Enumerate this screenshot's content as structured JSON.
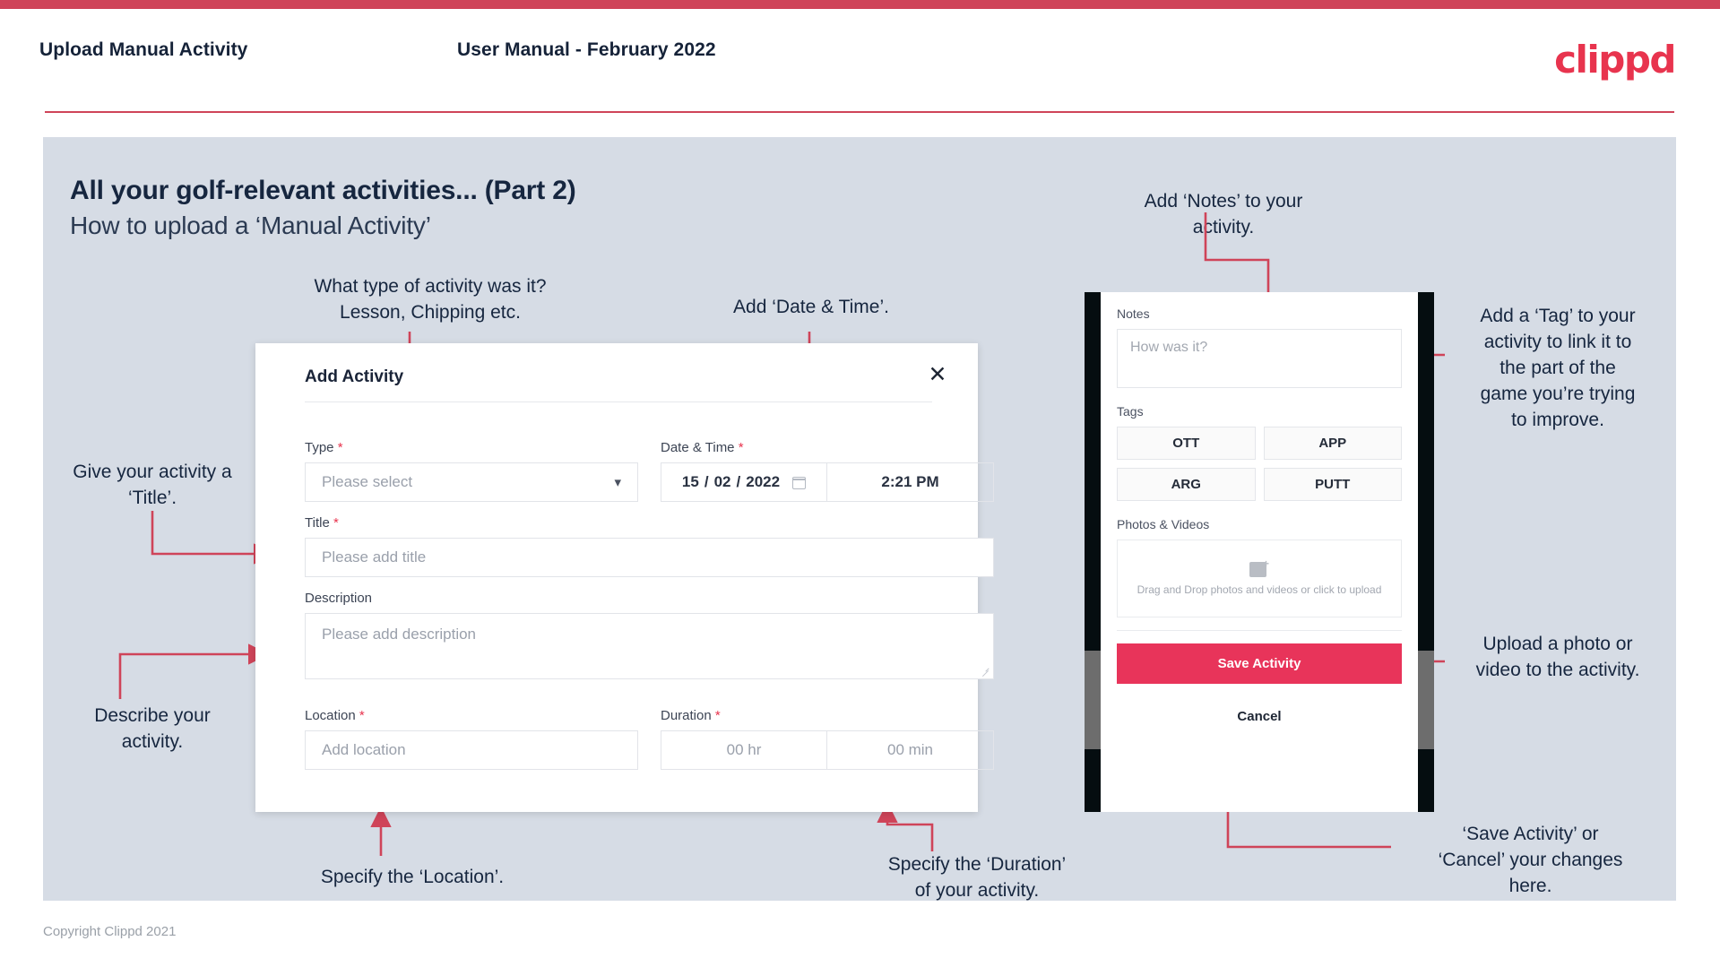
{
  "header": {
    "title": "Upload Manual Activity",
    "subtitle": "User Manual - February 2022",
    "brand": "clippd",
    "accent_color": "#cf4459"
  },
  "slide": {
    "title": "All your golf-relevant activities... (Part 2)",
    "subtitle": "How to upload a ‘Manual Activity’",
    "background_color": "#d6dce5"
  },
  "annotations": {
    "type": "What type of activity was it?\nLesson, Chipping etc.",
    "datetime": "Add ‘Date & Time’.",
    "notes": "Add ‘Notes’ to your\nactivity.",
    "tag": "Add a ‘Tag’ to your\nactivity to link it to\nthe part of the\ngame you’re trying\nto improve.",
    "title_field": "Give your activity a\n‘Title’.",
    "description": "Describe your\nactivity.",
    "upload": "Upload a photo or\nvideo to the activity.",
    "save_cancel": "‘Save Activity’ or\n‘Cancel’ your changes\nhere.",
    "location": "Specify the ‘Location’.",
    "duration": "Specify the ‘Duration’\nof your activity.",
    "arrow_color": "#cf4459"
  },
  "dialog": {
    "title": "Add Activity",
    "close_icon": "close-icon",
    "fields": {
      "type": {
        "label": "Type",
        "required": true,
        "placeholder": "Please select",
        "icon": "chevron-down-icon"
      },
      "datetime": {
        "label": "Date & Time",
        "required": true,
        "day": "15",
        "month": "02",
        "year": "2022",
        "separator": "/",
        "time": "2:21 PM",
        "icon": "calendar-icon"
      },
      "title": {
        "label": "Title",
        "required": true,
        "placeholder": "Please add title"
      },
      "description": {
        "label": "Description",
        "required": false,
        "placeholder": "Please add description"
      },
      "location": {
        "label": "Location",
        "required": true,
        "placeholder": "Add location"
      },
      "duration": {
        "label": "Duration",
        "required": true,
        "hours_placeholder": "00 hr",
        "minutes_placeholder": "00 min"
      }
    }
  },
  "phone": {
    "notes": {
      "label": "Notes",
      "placeholder": "How was it?"
    },
    "tags": {
      "label": "Tags",
      "items": [
        "OTT",
        "APP",
        "ARG",
        "PUTT"
      ]
    },
    "photos": {
      "label": "Photos & Videos",
      "drop_text": "Drag and Drop photos and videos or click to upload",
      "icon": "image-upload-icon"
    },
    "save_label": "Save Activity",
    "cancel_label": "Cancel",
    "save_color": "#e8345a"
  },
  "footer": {
    "copyright": "Copyright Clippd 2021"
  }
}
